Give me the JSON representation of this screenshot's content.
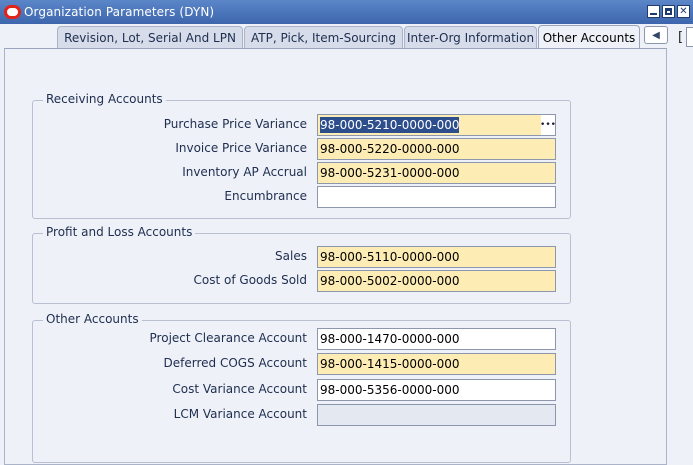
{
  "window": {
    "title": "Organization Parameters (DYN)",
    "controls": [
      "minimize",
      "maximize",
      "close"
    ]
  },
  "tabs": [
    {
      "label": "Revision, Lot, Serial And LPN",
      "active": false
    },
    {
      "label": "ATP, Pick, Item-Sourcing",
      "active": false
    },
    {
      "label": "Inter-Org Information",
      "active": false
    },
    {
      "label": "Other Accounts",
      "active": true
    }
  ],
  "tab_nav": {
    "bracket": "["
  },
  "groups": {
    "receiving": {
      "title": "Receiving Accounts",
      "fields": [
        {
          "label": "Purchase Price Variance",
          "value": "98-000-5210-0000-000",
          "required": true,
          "selected": true,
          "lov": true
        },
        {
          "label": "Invoice Price Variance",
          "value": "98-000-5220-0000-000",
          "required": true
        },
        {
          "label": "Inventory AP Accrual",
          "value": "98-000-5231-0000-000",
          "required": true
        },
        {
          "label": "Encumbrance",
          "value": "",
          "required": false
        }
      ]
    },
    "profit_loss": {
      "title": "Profit and Loss Accounts",
      "fields": [
        {
          "label": "Sales",
          "value": "98-000-5110-0000-000",
          "required": true
        },
        {
          "label": "Cost of Goods Sold",
          "value": "98-000-5002-0000-000",
          "required": true
        }
      ]
    },
    "other": {
      "title": "Other Accounts",
      "fields": [
        {
          "label": "Project Clearance Account",
          "value": "98-000-1470-0000-000",
          "required": false
        },
        {
          "label": "Deferred COGS Account",
          "value": "98-000-1415-0000-000",
          "required": true
        },
        {
          "label": "Cost Variance Account",
          "value": "98-000-5356-0000-000",
          "required": false
        },
        {
          "label": "LCM Variance Account",
          "value": "",
          "disabled": true
        }
      ]
    }
  },
  "colors": {
    "required_field": "#fdedb4",
    "selection": "#2d4e8c",
    "titlebar": "#3d66ad"
  }
}
